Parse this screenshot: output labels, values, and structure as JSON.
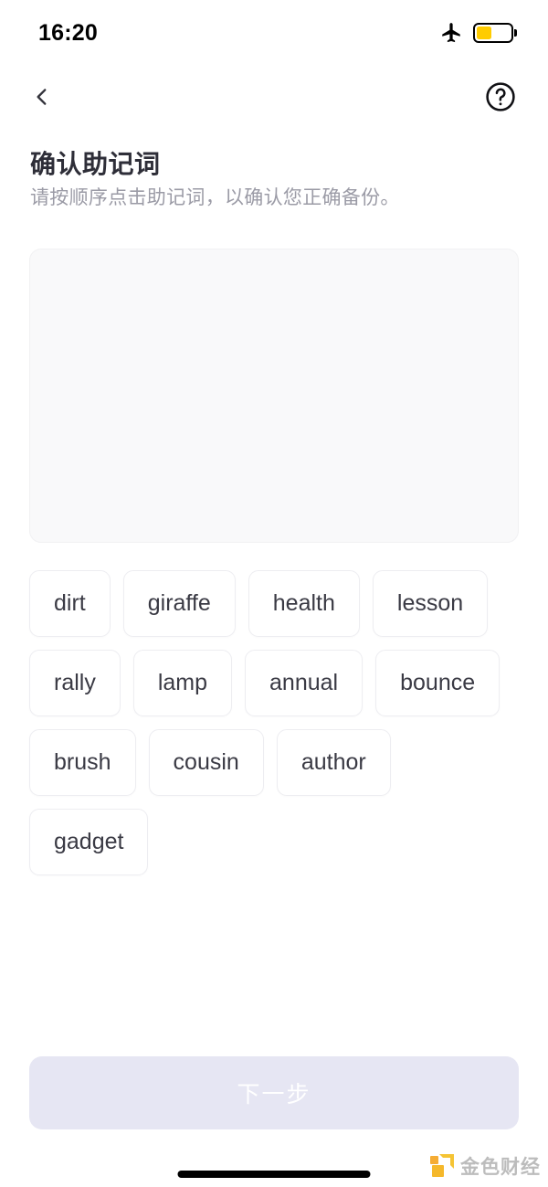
{
  "status_bar": {
    "time": "16:20",
    "airplane_icon": "airplane-icon",
    "battery_icon": "battery-icon",
    "battery_level_percent": 45,
    "battery_color": "#ffcc00"
  },
  "nav_bar": {
    "back_icon": "chevron-left-icon",
    "help_icon": "help-circle-icon"
  },
  "header": {
    "title": "确认助记词",
    "subtitle": "请按顺序点击助记词，以确认您正确备份。"
  },
  "answer_area": {
    "selected_words": [],
    "background_color": "#f9f9fa"
  },
  "word_pool": {
    "words": [
      "dirt",
      "giraffe",
      "health",
      "lesson",
      "rally",
      "lamp",
      "annual",
      "bounce",
      "brush",
      "cousin",
      "author",
      "gadget"
    ]
  },
  "footer": {
    "next_label": "下一步",
    "next_enabled": false,
    "next_bg_color": "#e6e6f3",
    "next_text_color": "#ffffff"
  },
  "watermark": {
    "text": "金色财经",
    "logo_color": "#f5b31a"
  }
}
